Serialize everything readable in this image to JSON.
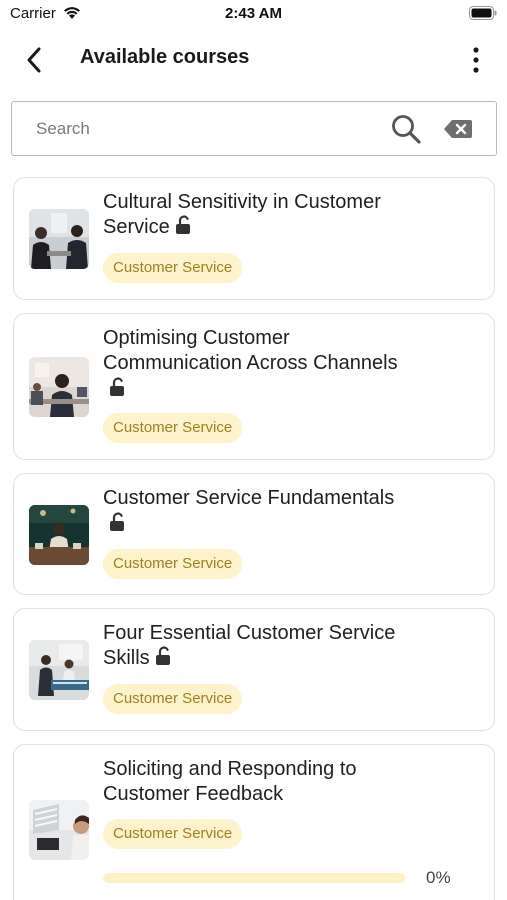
{
  "status_bar": {
    "carrier": "Carrier",
    "time": "2:43 AM",
    "icons": [
      "wifi-icon",
      "battery-icon"
    ]
  },
  "nav": {
    "title": "Available courses",
    "back_icon": "chevron-left-icon",
    "more_icon": "more-vertical-icon"
  },
  "search": {
    "placeholder": "Search",
    "value": "",
    "search_icon": "search-icon",
    "clear_icon": "clear-icon"
  },
  "colors": {
    "tag_background": "#fff3cc",
    "tag_text": "#a0801a",
    "progress_track": "#fdf0c4",
    "card_border": "#e1e1e1"
  },
  "courses": [
    {
      "title": "Cultural Sensitivity in Customer Service",
      "category": "Customer Service",
      "locked": false
    },
    {
      "title": "Optimising Customer Communication Across Channels",
      "category": "Customer Service",
      "locked": false
    },
    {
      "title": "Customer Service Fundamentals",
      "category": "Customer Service",
      "locked": false
    },
    {
      "title": "Four Essential Customer Service Skills",
      "category": "Customer Service",
      "locked": false
    },
    {
      "title": "Soliciting and Responding to Customer Feedback",
      "category": "Customer Service",
      "progress": 0,
      "progress_label": "0%"
    }
  ]
}
